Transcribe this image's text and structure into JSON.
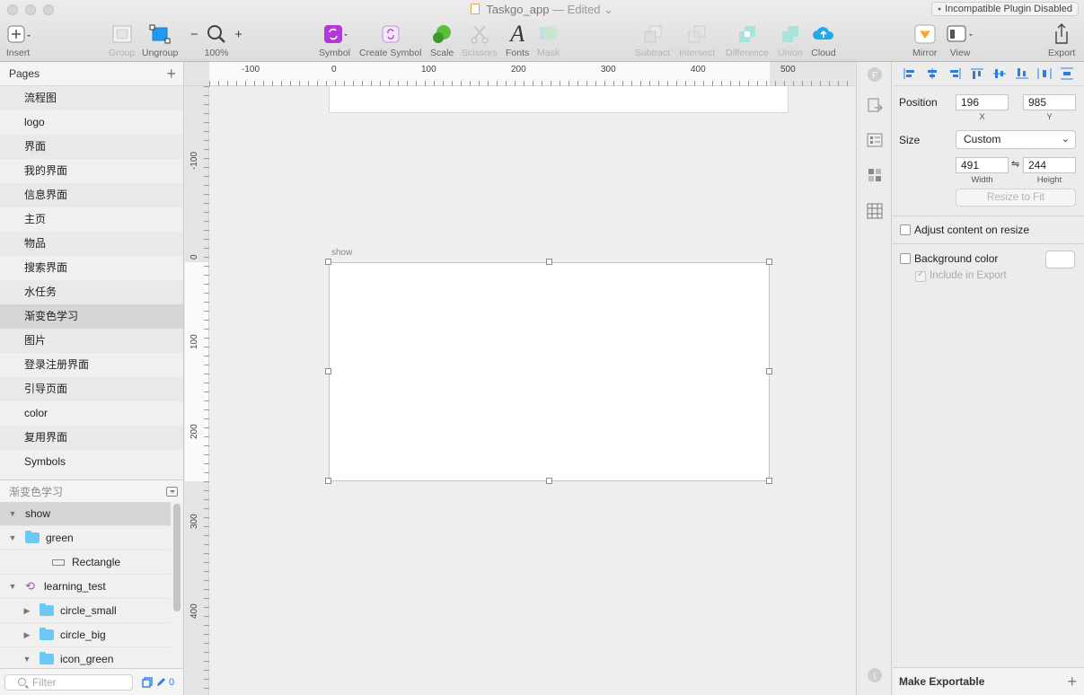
{
  "window": {
    "title": "Taskgo_app",
    "edited": "— Edited",
    "plugin_badge": "Incompatible Plugin Disabled"
  },
  "toolbar": {
    "insert": "Insert",
    "group": "Group",
    "ungroup": "Ungroup",
    "zoom_minus": "−",
    "zoom_plus": "+",
    "zoom_level": "100%",
    "symbol": "Symbol",
    "create_symbol": "Create Symbol",
    "scale": "Scale",
    "scissors": "Scissors",
    "fonts": "Fonts",
    "mask": "Mask",
    "subtract": "Subtract",
    "intersect": "Intersect",
    "difference": "Difference",
    "union": "Union",
    "cloud": "Cloud",
    "mirror": "Mirror",
    "view": "View",
    "export": "Export"
  },
  "pages": {
    "header": "Pages",
    "items": [
      "流程图",
      "logo",
      "界面",
      "我的界面",
      "信息界面",
      "主页",
      "物品",
      "搜索界面",
      "水任务",
      "渐变色学习",
      "图片",
      "登录注册界面",
      "引导页面",
      "color",
      "复用界面",
      "Symbols"
    ],
    "selected_index": 9
  },
  "layers": {
    "header": "渐变色学习",
    "items": [
      {
        "name": "show",
        "kind": "artboard",
        "indent": 0,
        "expanded": true,
        "selected": true
      },
      {
        "name": "green",
        "kind": "folder",
        "indent": 0,
        "expanded": true
      },
      {
        "name": "Rectangle",
        "kind": "rect",
        "indent": 1
      },
      {
        "name": "learning_test",
        "kind": "symbol",
        "indent": 0,
        "expanded": true
      },
      {
        "name": "circle_small",
        "kind": "folder",
        "indent": 1,
        "expanded": false
      },
      {
        "name": "circle_big",
        "kind": "folder",
        "indent": 1,
        "expanded": false
      },
      {
        "name": "icon_green",
        "kind": "folder",
        "indent": 1,
        "expanded": true
      }
    ],
    "filter_placeholder": "Filter",
    "footer_count": "0"
  },
  "rulers": {
    "h_ticks": [
      "-100",
      "0",
      "100",
      "200",
      "300",
      "400",
      "500"
    ],
    "v_ticks": [
      "-100",
      "0",
      "100",
      "200",
      "300",
      "400"
    ]
  },
  "canvas": {
    "artboard_name": "show"
  },
  "inspector": {
    "position_label": "Position",
    "x_value": "196",
    "x_label": "X",
    "y_value": "985",
    "y_label": "Y",
    "size_label": "Size",
    "size_preset": "Custom",
    "width_value": "491",
    "width_label": "Width",
    "height_value": "244",
    "height_label": "Height",
    "lock_glyph": "⇋",
    "resize_to_fit": "Resize to Fit",
    "adjust_content": "Adjust content on resize",
    "background_color": "Background color",
    "include_in_export": "Include in Export",
    "make_exportable": "Make Exportable"
  },
  "colors": {
    "accent": "#2a7de1",
    "symbol_purple": "#b13bd6",
    "folder_blue": "#6ec8f5",
    "selection_gray": "#d6d6d6"
  }
}
